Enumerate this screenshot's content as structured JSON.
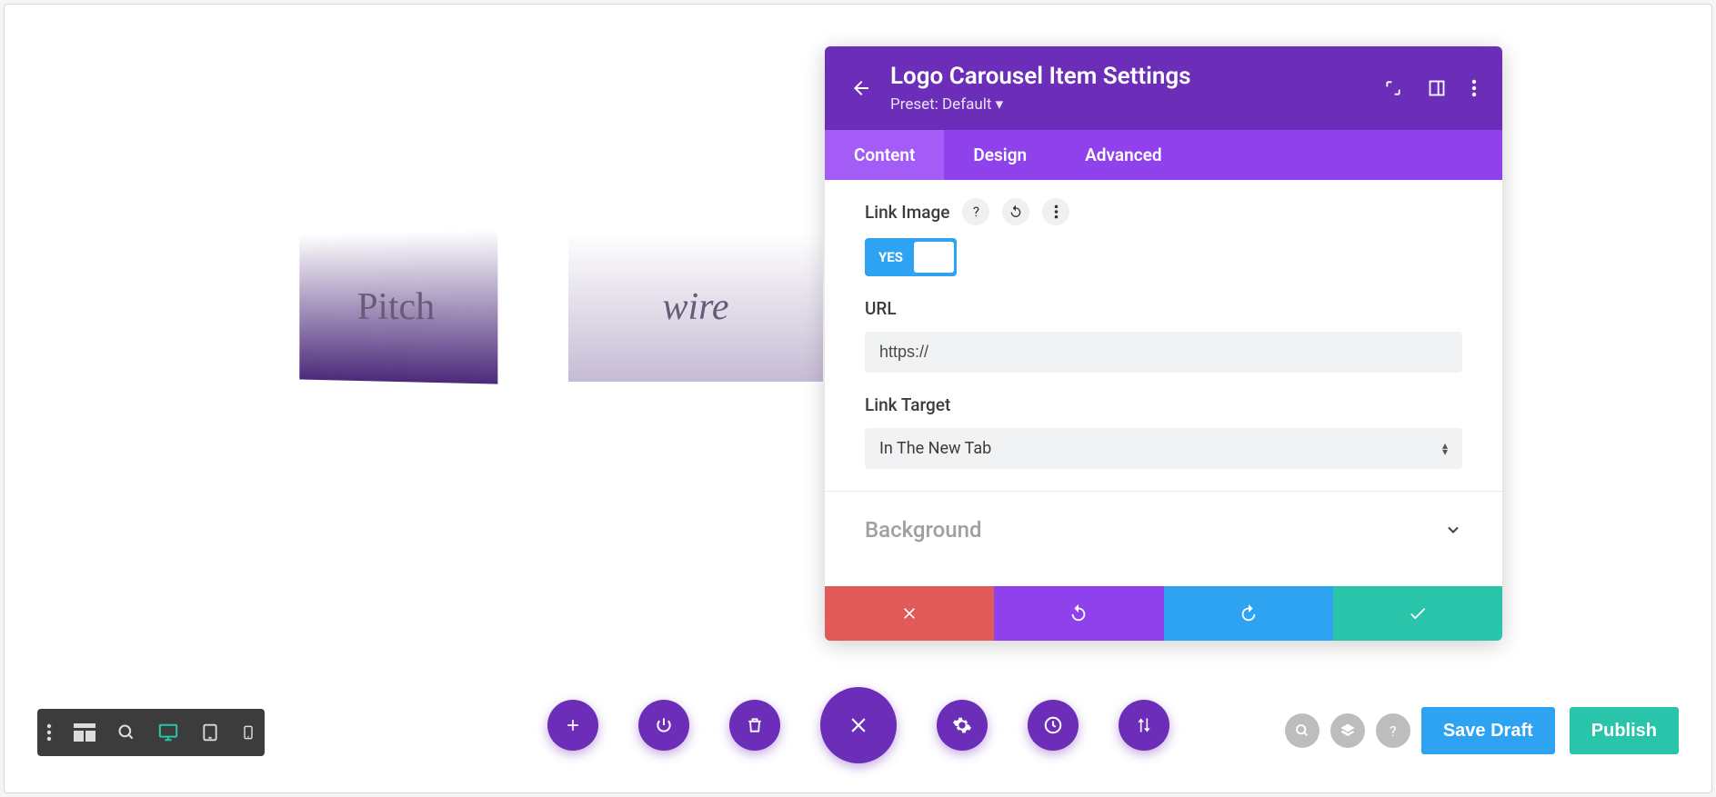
{
  "modal": {
    "title": "Logo Carousel Item Settings",
    "preset": "Preset: Default",
    "tabs": {
      "content": "Content",
      "design": "Design",
      "advanced": "Advanced"
    },
    "fields": {
      "link_image_label": "Link Image",
      "toggle_yes": "YES",
      "url_label": "URL",
      "url_value": "https://",
      "link_target_label": "Link Target",
      "link_target_value": "In The New Tab"
    },
    "accordion": {
      "background": "Background"
    }
  },
  "canvas": {
    "logo1": "Pitch",
    "logo2": "wire"
  },
  "actions": {
    "save_draft": "Save Draft",
    "publish": "Publish"
  }
}
